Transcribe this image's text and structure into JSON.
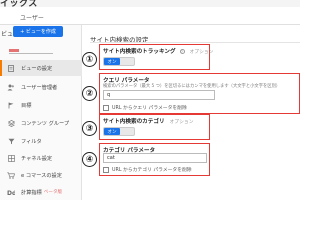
{
  "header": {
    "brand_fragment": "イックス",
    "user_tab": "ユーザー"
  },
  "sidebar": {
    "view_label": "ビュー",
    "create_view": "+ ビューを作成",
    "items": [
      {
        "label": "ビューの設定",
        "icon": "document-icon"
      },
      {
        "label": "ユーザー管理者",
        "icon": "users-icon"
      },
      {
        "label": "目標",
        "icon": "flag-icon"
      },
      {
        "label": "コンテンツ グループ",
        "icon": "content-group-icon"
      },
      {
        "label": "フィルタ",
        "icon": "filter-icon"
      },
      {
        "label": "チャネル設定",
        "icon": "channel-icon"
      },
      {
        "label": "e コマースの設定",
        "icon": "cart-icon"
      },
      {
        "label": "計算指標",
        "badge": "ベータ版",
        "icon": "calculator-icon"
      }
    ]
  },
  "main": {
    "title": "サイト内検索の設定",
    "markers": [
      "①",
      "②",
      "③",
      "④"
    ],
    "tracking": {
      "label": "サイト内検索のトラッキング",
      "help": "?",
      "optional": "オプション",
      "toggle": "オン"
    },
    "query": {
      "label": "クエリ パラメータ",
      "description": "検索のパラメータ（最大 5 つ）を区切るにはカンマを使用します（大文字と小文字を区別）",
      "value": "q",
      "strip_label": "URL からクエリ パラメータを削除"
    },
    "category": {
      "label": "サイト内検索のカテゴリ",
      "optional": "オプション",
      "toggle": "オン"
    },
    "category_param": {
      "label": "カテゴリ パラメータ",
      "value": "cat",
      "strip_label": "URL からカテゴリ パラメータを削除"
    }
  },
  "colors": {
    "accent_blue": "#1a73e8",
    "callout_red": "#e53935",
    "active_marker": "#f57c00"
  }
}
